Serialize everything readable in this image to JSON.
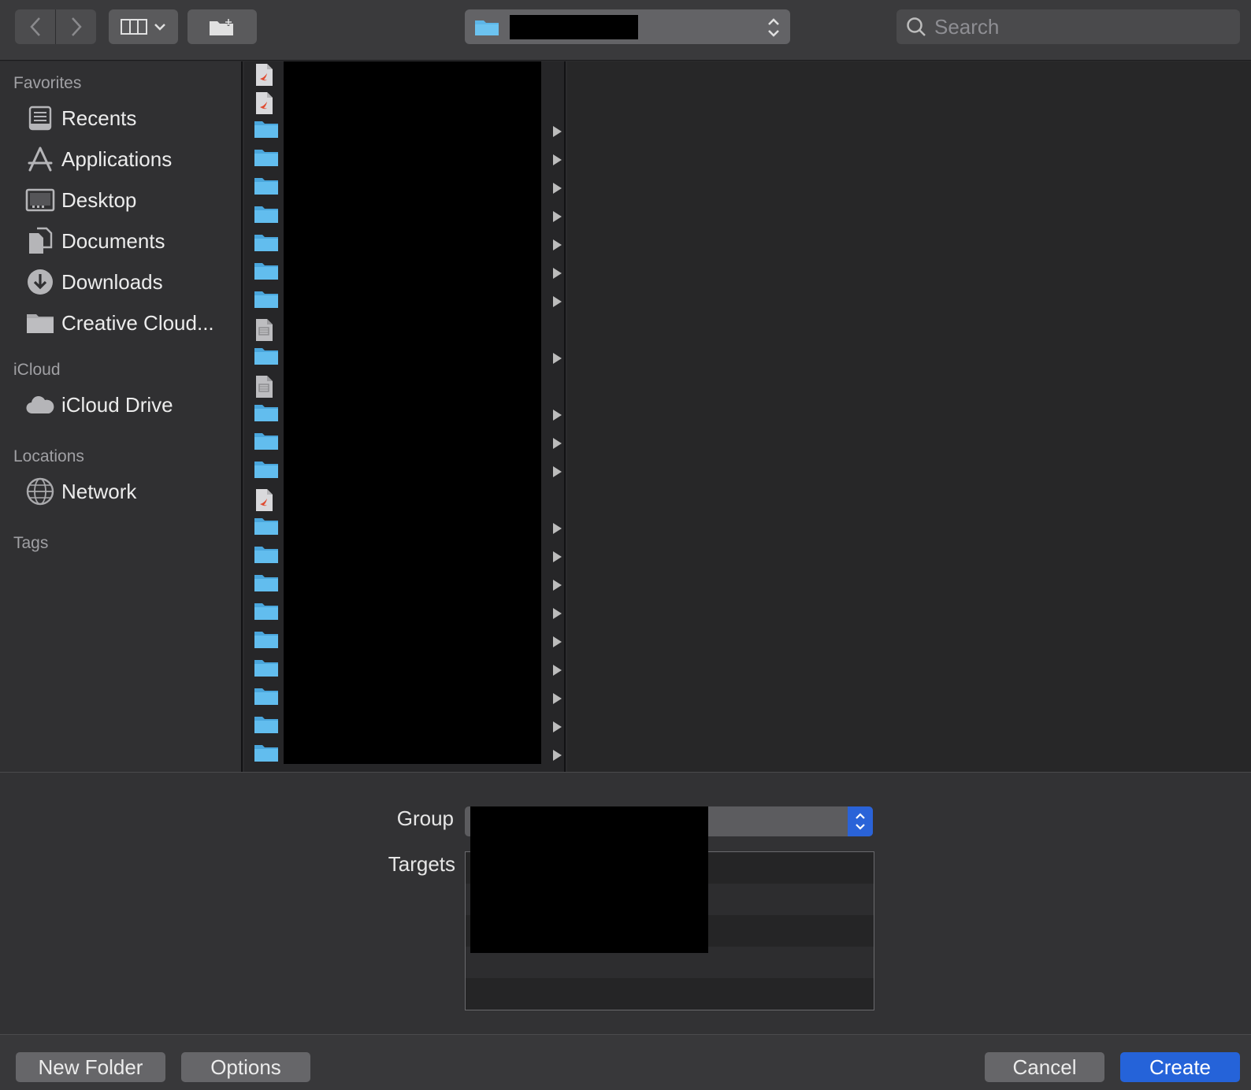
{
  "toolbar": {
    "search_placeholder": "Search"
  },
  "sidebar": {
    "sections": {
      "favorites": "Favorites",
      "icloud": "iCloud",
      "locations": "Locations",
      "tags": "Tags"
    },
    "favorites": [
      {
        "label": "Recents",
        "icon": "recents-icon"
      },
      {
        "label": "Applications",
        "icon": "applications-icon"
      },
      {
        "label": "Desktop",
        "icon": "desktop-icon"
      },
      {
        "label": "Documents",
        "icon": "documents-icon"
      },
      {
        "label": "Downloads",
        "icon": "downloads-icon"
      },
      {
        "label": "Creative Cloud...",
        "icon": "folder-icon"
      }
    ],
    "icloud": [
      {
        "label": "iCloud Drive",
        "icon": "cloud-icon"
      }
    ],
    "locations": [
      {
        "label": "Network",
        "icon": "network-icon"
      }
    ]
  },
  "file_column": {
    "rows": [
      "swift-file",
      "swift-file",
      "folder",
      "folder",
      "folder",
      "folder",
      "folder",
      "folder",
      "folder",
      "plist-file",
      "folder",
      "plist-file",
      "folder",
      "folder",
      "folder",
      "swift-file",
      "folder",
      "folder",
      "folder",
      "folder",
      "folder",
      "folder",
      "folder",
      "folder",
      "folder"
    ]
  },
  "options": {
    "group_label": "Group",
    "targets_label": "Targets"
  },
  "buttons": {
    "new_folder": "New Folder",
    "options": "Options",
    "cancel": "Cancel",
    "create": "Create"
  },
  "colors": {
    "accent": "#2563d9",
    "folder": "#5db6e8"
  }
}
